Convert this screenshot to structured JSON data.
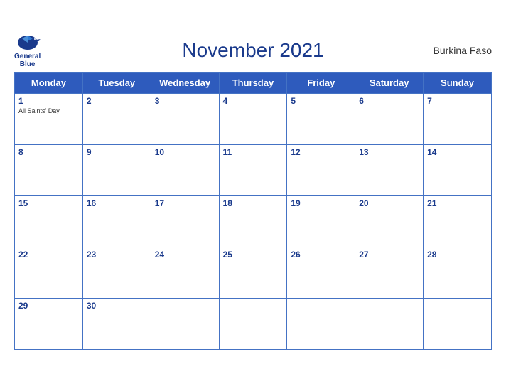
{
  "header": {
    "title": "November 2021",
    "country": "Burkina Faso",
    "logo": {
      "line1": "General",
      "line2": "Blue"
    }
  },
  "weekdays": [
    "Monday",
    "Tuesday",
    "Wednesday",
    "Thursday",
    "Friday",
    "Saturday",
    "Sunday"
  ],
  "weeks": [
    [
      {
        "day": 1,
        "holiday": "All Saints' Day"
      },
      {
        "day": 2,
        "holiday": ""
      },
      {
        "day": 3,
        "holiday": ""
      },
      {
        "day": 4,
        "holiday": ""
      },
      {
        "day": 5,
        "holiday": ""
      },
      {
        "day": 6,
        "holiday": ""
      },
      {
        "day": 7,
        "holiday": ""
      }
    ],
    [
      {
        "day": 8,
        "holiday": ""
      },
      {
        "day": 9,
        "holiday": ""
      },
      {
        "day": 10,
        "holiday": ""
      },
      {
        "day": 11,
        "holiday": ""
      },
      {
        "day": 12,
        "holiday": ""
      },
      {
        "day": 13,
        "holiday": ""
      },
      {
        "day": 14,
        "holiday": ""
      }
    ],
    [
      {
        "day": 15,
        "holiday": ""
      },
      {
        "day": 16,
        "holiday": ""
      },
      {
        "day": 17,
        "holiday": ""
      },
      {
        "day": 18,
        "holiday": ""
      },
      {
        "day": 19,
        "holiday": ""
      },
      {
        "day": 20,
        "holiday": ""
      },
      {
        "day": 21,
        "holiday": ""
      }
    ],
    [
      {
        "day": 22,
        "holiday": ""
      },
      {
        "day": 23,
        "holiday": ""
      },
      {
        "day": 24,
        "holiday": ""
      },
      {
        "day": 25,
        "holiday": ""
      },
      {
        "day": 26,
        "holiday": ""
      },
      {
        "day": 27,
        "holiday": ""
      },
      {
        "day": 28,
        "holiday": ""
      }
    ],
    [
      {
        "day": 29,
        "holiday": ""
      },
      {
        "day": 30,
        "holiday": ""
      },
      null,
      null,
      null,
      null,
      null
    ]
  ],
  "colors": {
    "header_bg": "#2e5bbd",
    "border": "#4472c4",
    "title": "#1a3a8c",
    "day_number": "#1a3a8c"
  }
}
